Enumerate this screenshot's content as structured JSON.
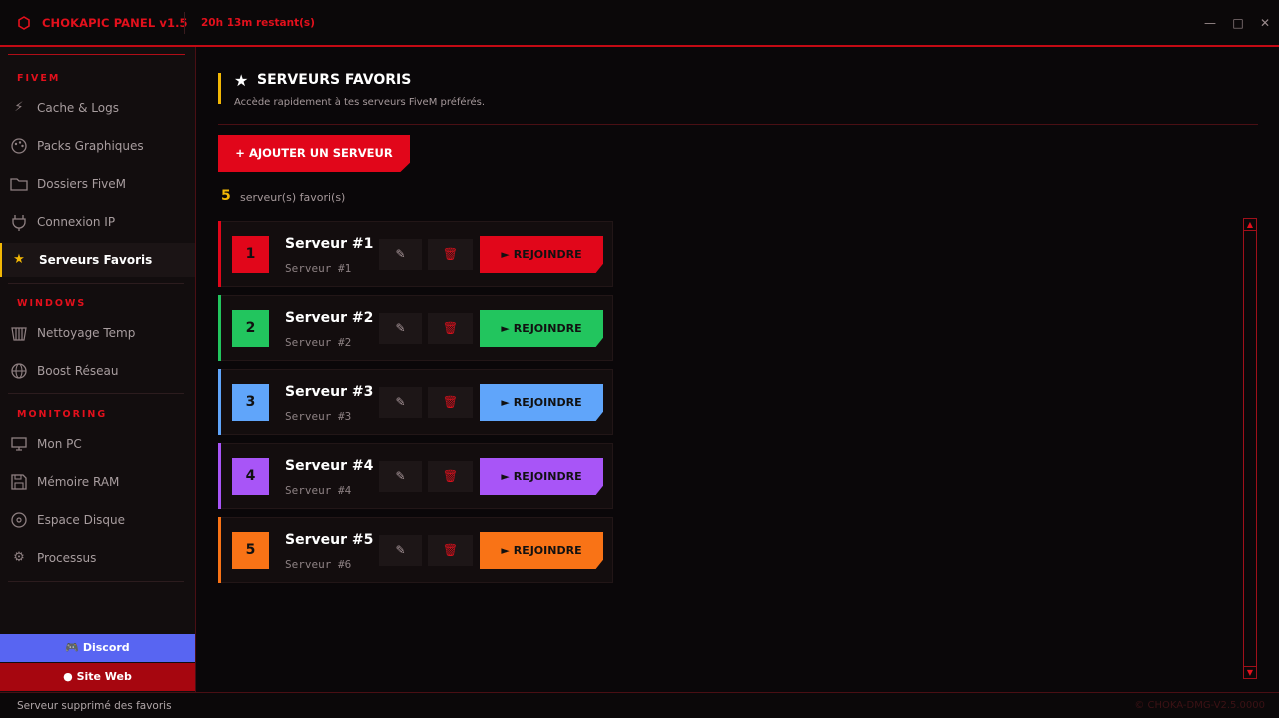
{
  "titlebar": {
    "title": "CHOKAPIC PANEL  v1.5",
    "timer": "20h 13m restant(s)"
  },
  "sidebar": {
    "sections": [
      {
        "label": "FIVEM"
      },
      {
        "label": "WINDOWS"
      },
      {
        "label": "MONITORING"
      }
    ],
    "items": [
      {
        "label": "Cache & Logs",
        "icon": "lightning-icon"
      },
      {
        "label": "Packs Graphiques",
        "icon": "palette-icon"
      },
      {
        "label": "Dossiers FiveM",
        "icon": "folder-icon"
      },
      {
        "label": "Connexion IP",
        "icon": "plug-icon"
      },
      {
        "label": "Serveurs Favoris",
        "icon": "star-icon",
        "active": true
      },
      {
        "label": "Nettoyage Temp",
        "icon": "trash-basket-icon"
      },
      {
        "label": "Boost Réseau",
        "icon": "globe-icon"
      },
      {
        "label": "Mon PC",
        "icon": "computer-icon"
      },
      {
        "label": "Mémoire RAM",
        "icon": "floppy-icon"
      },
      {
        "label": "Espace Disque",
        "icon": "disk-icon"
      },
      {
        "label": "Processus",
        "icon": "gear-icon"
      }
    ],
    "discord_label": "Discord",
    "web_label": "Site Web"
  },
  "page": {
    "title": "SERVEURS FAVORIS",
    "subtitle": "Accède rapidement à tes serveurs FiveM préférés.",
    "add_button": "AJOUTER UN SERVEUR",
    "count": "5",
    "count_label": "serveur(s) favori(s)"
  },
  "servers": [
    {
      "index": "1",
      "name": "Serveur #1",
      "address": "Serveur #1",
      "color": "#e1061a",
      "join_label": "REJOINDRE"
    },
    {
      "index": "2",
      "name": "Serveur #2",
      "address": "Serveur #2",
      "color": "#22c55e",
      "join_label": "REJOINDRE"
    },
    {
      "index": "3",
      "name": "Serveur #3",
      "address": "Serveur #3",
      "color": "#60a5fa",
      "join_label": "REJOINDRE"
    },
    {
      "index": "4",
      "name": "Serveur #4",
      "address": "Serveur #4",
      "color": "#a855f7",
      "join_label": "REJOINDRE"
    },
    {
      "index": "5",
      "name": "Serveur #5",
      "address": "Serveur #6",
      "color": "#f97316",
      "join_label": "REJOINDRE"
    }
  ],
  "statusbar": {
    "message": "Serveur supprimé des favoris",
    "right_text": "© CHOKA-DMG-V2.5.0000"
  },
  "colors": {
    "accent": "#e3101c",
    "active": "#f2b705",
    "discord": "#5865f2",
    "web": "#a6060f"
  }
}
